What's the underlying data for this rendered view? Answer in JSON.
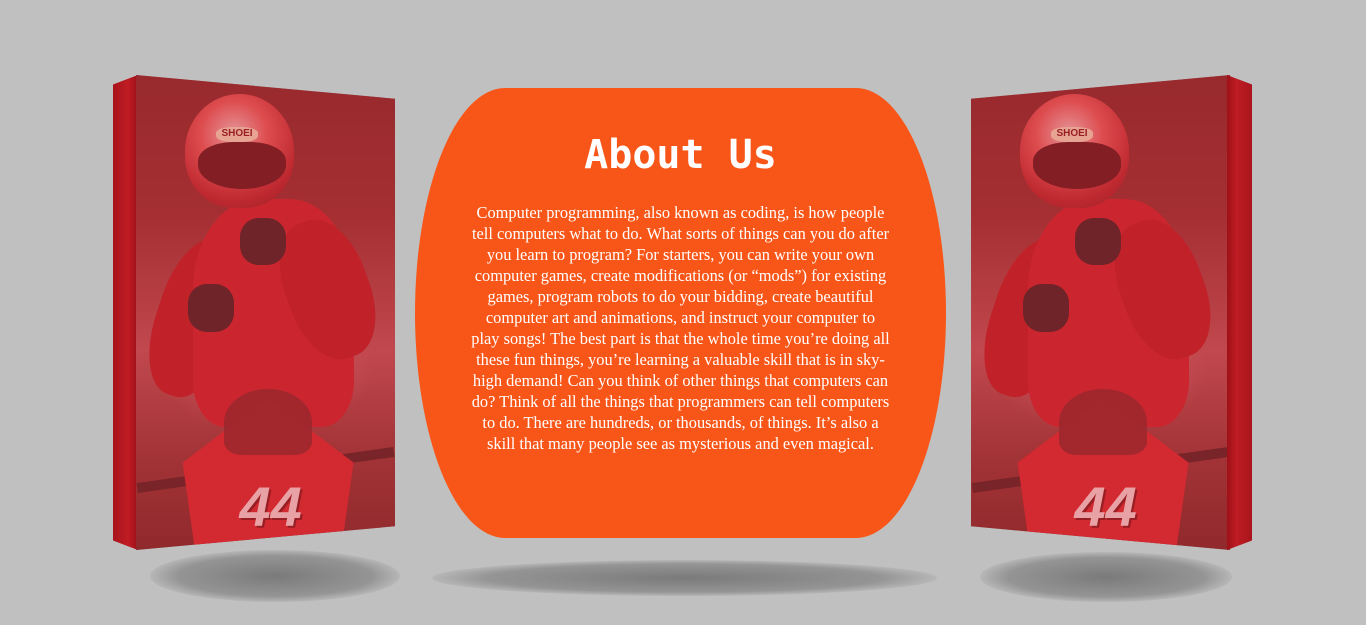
{
  "about": {
    "title": "About Us",
    "body": "Computer programming, also known as coding, is how people tell computers what to do. What sorts of things can you do after you learn to program? For starters, you can write your own computer games, create modifications (or “mods”) for existing games, program robots to do your bidding, create beautiful computer art and animations, and instruct your computer to play songs! The best part is that the whole time you’re doing all these fun things, you’re learning a valuable skill that is in sky-high demand! Can you think of other things that computers can do? Think of all the things that programmers can tell computers to do. There are hundreds, or thousands, of things. It’s also a skill that many people see as mysterious and even magical."
  },
  "panels": {
    "left": {
      "helmet_text": "SHOEI",
      "race_number": "44"
    },
    "right": {
      "helmet_text": "SHOEI",
      "race_number": "44"
    }
  },
  "colors": {
    "background": "#c0c0c0",
    "card": "#f85618",
    "panel_edge": "#c01c24",
    "text": "#ffffff"
  }
}
